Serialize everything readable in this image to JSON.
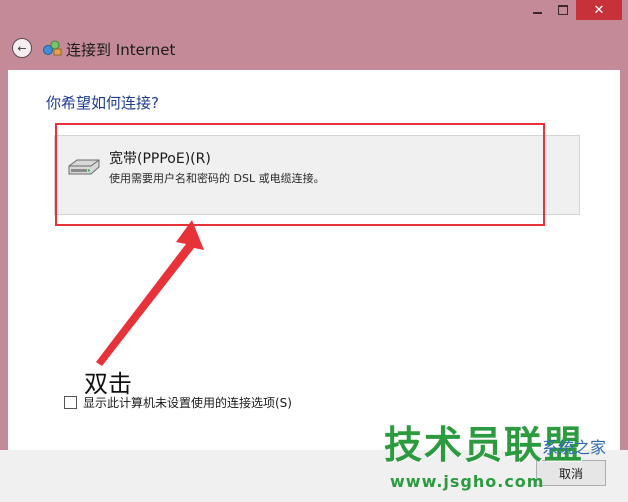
{
  "window": {
    "title": "连接到 Internet",
    "close_glyph": "✕"
  },
  "main": {
    "question": "你希望如何连接?",
    "option": {
      "title": "宽带(PPPoE)(R)",
      "description": "使用需要用户名和密码的 DSL 或电缆连接。"
    },
    "annotation": "双击",
    "checkbox_label": "显示此计算机未设置使用的连接选项(S)",
    "checkbox_checked": false
  },
  "footer": {
    "cancel_label": "取消"
  },
  "watermark": {
    "brand": "技术员联盟",
    "tagline": "系统之家",
    "url": "www.jsgho.com"
  },
  "colors": {
    "highlight": "#e8323a",
    "accent_blue": "#1e3d8f",
    "titlebar_bg": "#c48a98",
    "close_bg": "#c7323a",
    "watermark_green": "#2c9b40"
  },
  "icons": {
    "back": "back-arrow-icon",
    "network": "network-globe-icon",
    "broadband": "broadband-modem-icon"
  }
}
